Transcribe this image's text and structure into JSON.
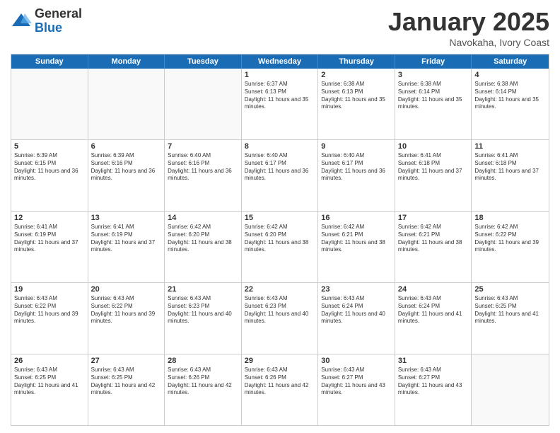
{
  "logo": {
    "general": "General",
    "blue": "Blue"
  },
  "title": {
    "month": "January 2025",
    "location": "Navokaha, Ivory Coast"
  },
  "header_days": [
    "Sunday",
    "Monday",
    "Tuesday",
    "Wednesday",
    "Thursday",
    "Friday",
    "Saturday"
  ],
  "weeks": [
    [
      {
        "day": "",
        "info": ""
      },
      {
        "day": "",
        "info": ""
      },
      {
        "day": "",
        "info": ""
      },
      {
        "day": "1",
        "info": "Sunrise: 6:37 AM\nSunset: 6:13 PM\nDaylight: 11 hours and 35 minutes."
      },
      {
        "day": "2",
        "info": "Sunrise: 6:38 AM\nSunset: 6:13 PM\nDaylight: 11 hours and 35 minutes."
      },
      {
        "day": "3",
        "info": "Sunrise: 6:38 AM\nSunset: 6:14 PM\nDaylight: 11 hours and 35 minutes."
      },
      {
        "day": "4",
        "info": "Sunrise: 6:38 AM\nSunset: 6:14 PM\nDaylight: 11 hours and 35 minutes."
      }
    ],
    [
      {
        "day": "5",
        "info": "Sunrise: 6:39 AM\nSunset: 6:15 PM\nDaylight: 11 hours and 36 minutes."
      },
      {
        "day": "6",
        "info": "Sunrise: 6:39 AM\nSunset: 6:16 PM\nDaylight: 11 hours and 36 minutes."
      },
      {
        "day": "7",
        "info": "Sunrise: 6:40 AM\nSunset: 6:16 PM\nDaylight: 11 hours and 36 minutes."
      },
      {
        "day": "8",
        "info": "Sunrise: 6:40 AM\nSunset: 6:17 PM\nDaylight: 11 hours and 36 minutes."
      },
      {
        "day": "9",
        "info": "Sunrise: 6:40 AM\nSunset: 6:17 PM\nDaylight: 11 hours and 36 minutes."
      },
      {
        "day": "10",
        "info": "Sunrise: 6:41 AM\nSunset: 6:18 PM\nDaylight: 11 hours and 37 minutes."
      },
      {
        "day": "11",
        "info": "Sunrise: 6:41 AM\nSunset: 6:18 PM\nDaylight: 11 hours and 37 minutes."
      }
    ],
    [
      {
        "day": "12",
        "info": "Sunrise: 6:41 AM\nSunset: 6:19 PM\nDaylight: 11 hours and 37 minutes."
      },
      {
        "day": "13",
        "info": "Sunrise: 6:41 AM\nSunset: 6:19 PM\nDaylight: 11 hours and 37 minutes."
      },
      {
        "day": "14",
        "info": "Sunrise: 6:42 AM\nSunset: 6:20 PM\nDaylight: 11 hours and 38 minutes."
      },
      {
        "day": "15",
        "info": "Sunrise: 6:42 AM\nSunset: 6:20 PM\nDaylight: 11 hours and 38 minutes."
      },
      {
        "day": "16",
        "info": "Sunrise: 6:42 AM\nSunset: 6:21 PM\nDaylight: 11 hours and 38 minutes."
      },
      {
        "day": "17",
        "info": "Sunrise: 6:42 AM\nSunset: 6:21 PM\nDaylight: 11 hours and 38 minutes."
      },
      {
        "day": "18",
        "info": "Sunrise: 6:42 AM\nSunset: 6:22 PM\nDaylight: 11 hours and 39 minutes."
      }
    ],
    [
      {
        "day": "19",
        "info": "Sunrise: 6:43 AM\nSunset: 6:22 PM\nDaylight: 11 hours and 39 minutes."
      },
      {
        "day": "20",
        "info": "Sunrise: 6:43 AM\nSunset: 6:22 PM\nDaylight: 11 hours and 39 minutes."
      },
      {
        "day": "21",
        "info": "Sunrise: 6:43 AM\nSunset: 6:23 PM\nDaylight: 11 hours and 40 minutes."
      },
      {
        "day": "22",
        "info": "Sunrise: 6:43 AM\nSunset: 6:23 PM\nDaylight: 11 hours and 40 minutes."
      },
      {
        "day": "23",
        "info": "Sunrise: 6:43 AM\nSunset: 6:24 PM\nDaylight: 11 hours and 40 minutes."
      },
      {
        "day": "24",
        "info": "Sunrise: 6:43 AM\nSunset: 6:24 PM\nDaylight: 11 hours and 41 minutes."
      },
      {
        "day": "25",
        "info": "Sunrise: 6:43 AM\nSunset: 6:25 PM\nDaylight: 11 hours and 41 minutes."
      }
    ],
    [
      {
        "day": "26",
        "info": "Sunrise: 6:43 AM\nSunset: 6:25 PM\nDaylight: 11 hours and 41 minutes."
      },
      {
        "day": "27",
        "info": "Sunrise: 6:43 AM\nSunset: 6:25 PM\nDaylight: 11 hours and 42 minutes."
      },
      {
        "day": "28",
        "info": "Sunrise: 6:43 AM\nSunset: 6:26 PM\nDaylight: 11 hours and 42 minutes."
      },
      {
        "day": "29",
        "info": "Sunrise: 6:43 AM\nSunset: 6:26 PM\nDaylight: 11 hours and 42 minutes."
      },
      {
        "day": "30",
        "info": "Sunrise: 6:43 AM\nSunset: 6:27 PM\nDaylight: 11 hours and 43 minutes."
      },
      {
        "day": "31",
        "info": "Sunrise: 6:43 AM\nSunset: 6:27 PM\nDaylight: 11 hours and 43 minutes."
      },
      {
        "day": "",
        "info": ""
      }
    ]
  ]
}
